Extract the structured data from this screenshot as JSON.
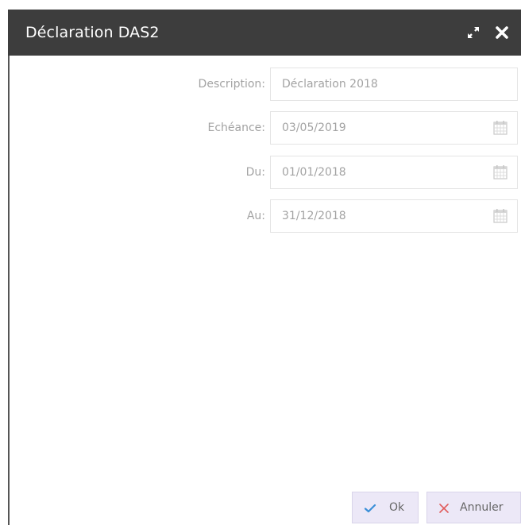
{
  "window": {
    "title": "Déclaration DAS2",
    "maximize_icon": "expand-arrows-icon",
    "close_icon": "close-x-icon"
  },
  "form": {
    "description": {
      "label": "Description:",
      "value": "Déclaration 2018"
    },
    "echeance": {
      "label": "Echéance:",
      "value": "03/05/2019",
      "icon": "calendar-icon"
    },
    "du": {
      "label": "Du:",
      "value": "01/01/2018",
      "icon": "calendar-icon"
    },
    "au": {
      "label": "Au:",
      "value": "31/12/2018",
      "icon": "calendar-icon"
    }
  },
  "buttons": {
    "ok": {
      "label": "Ok",
      "icon": "checkmark-icon",
      "icon_color": "#3a8fd8"
    },
    "cancel": {
      "label": "Annuler",
      "icon": "close-icon",
      "icon_color": "#e05c5c"
    }
  },
  "colors": {
    "titlebar": "#3d3d3d",
    "button_bg": "#ece8f7",
    "label_text": "#a3a3a3"
  }
}
